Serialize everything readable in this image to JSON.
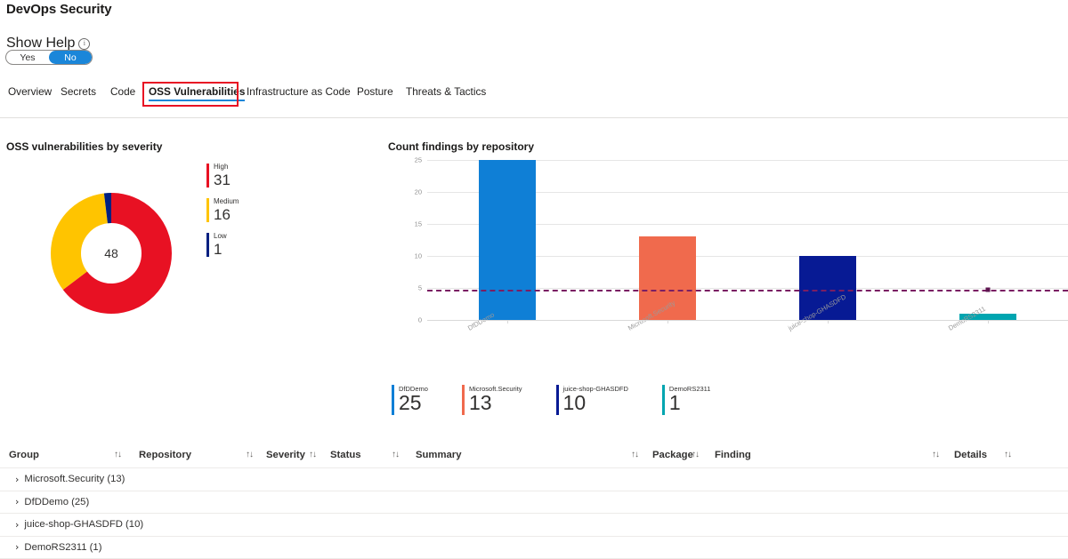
{
  "header": {
    "title": "DevOps Security",
    "help_label": "Show Help",
    "info_icon": "info-icon",
    "toggle": {
      "yes": "Yes",
      "no": "No",
      "selected": "No"
    }
  },
  "tabs": [
    {
      "label": "Overview",
      "active": false
    },
    {
      "label": "Secrets",
      "active": false
    },
    {
      "label": "Code",
      "active": false
    },
    {
      "label": "OSS Vulnerabilities",
      "active": true
    },
    {
      "label": "Infrastructure as Code",
      "active": false
    },
    {
      "label": "Posture",
      "active": false
    },
    {
      "label": "Threats & Tactics",
      "active": false
    }
  ],
  "donut_section": {
    "title": "OSS vulnerabilities by severity"
  },
  "bar_section": {
    "title": "Count findings by repository"
  },
  "table": {
    "columns": [
      {
        "label": "Group",
        "sort": "↑↓"
      },
      {
        "label": "Repository",
        "sort": "↑↓"
      },
      {
        "label": "Severity",
        "sort": "↑↓"
      },
      {
        "label": "Status",
        "sort": "↑↓"
      },
      {
        "label": "Summary",
        "sort": "↑↓"
      },
      {
        "label": "Package",
        "sort": "↑↓"
      },
      {
        "label": "Finding",
        "sort": "↑↓"
      },
      {
        "label": "Details",
        "sort": "↑↓"
      }
    ],
    "rows": [
      {
        "chevron": "›",
        "label": "Microsoft.Security (13)"
      },
      {
        "chevron": "›",
        "label": "DfDDemo (25)"
      },
      {
        "chevron": "›",
        "label": "juice-shop-GHASDFD (10)"
      },
      {
        "chevron": "›",
        "label": "DemoRS2311 (1)"
      }
    ]
  },
  "chart_data": [
    {
      "type": "pie",
      "title": "OSS vulnerabilities by severity",
      "center_label": "48",
      "total": 48,
      "categories": [
        "High",
        "Medium",
        "Low"
      ],
      "values": [
        31,
        16,
        1
      ],
      "colors": [
        "#e81123",
        "#ffc400",
        "#002080"
      ],
      "legend_position": "right",
      "donut": true
    },
    {
      "type": "bar",
      "title": "Count findings by repository",
      "categories": [
        "DfDDemo",
        "Microsoft.Security",
        "juice-shop-GHASDFD",
        "DemoRS2311"
      ],
      "values": [
        25,
        13,
        10,
        1
      ],
      "colors": [
        "#0f7fd6",
        "#f06a4d",
        "#071a94",
        "#00a5b0"
      ],
      "xlabel": "",
      "ylabel": "",
      "ylim": [
        0,
        25
      ],
      "yticks": [
        0,
        5,
        10,
        15,
        20,
        25
      ],
      "grid": true,
      "legend_position": "bottom",
      "threshold_line": {
        "value": 4.7,
        "style": "dashed",
        "color": "#7a1e63"
      }
    }
  ]
}
